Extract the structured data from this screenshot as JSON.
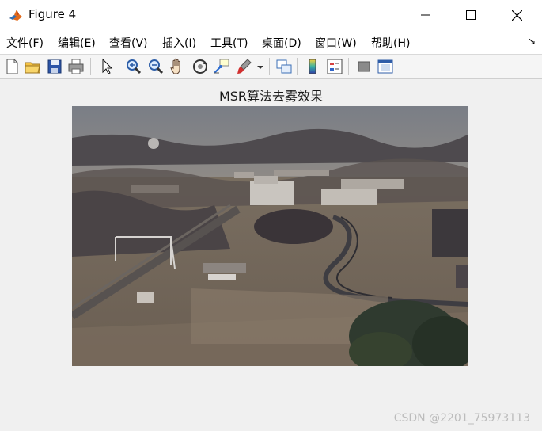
{
  "window": {
    "title": "Figure 4"
  },
  "menu": [
    "文件(F)",
    "编辑(E)",
    "查看(V)",
    "插入(I)",
    "工具(T)",
    "桌面(D)",
    "窗口(W)",
    "帮助(H)"
  ],
  "toolbar": {
    "icons": [
      "new-figure-icon",
      "open-file-icon",
      "save-icon",
      "print-icon",
      "select-arrow-icon",
      "zoom-in-icon",
      "zoom-out-icon",
      "pan-hand-icon",
      "rotate-3d-icon",
      "data-cursor-icon",
      "brush-icon",
      "link-plot-icon",
      "insert-colorbar-icon",
      "insert-legend-icon",
      "hide-plot-tools-icon",
      "show-plot-tools-icon"
    ]
  },
  "figure": {
    "title": "MSR算法去雾效果"
  },
  "watermark": "CSDN @2201_75973113"
}
